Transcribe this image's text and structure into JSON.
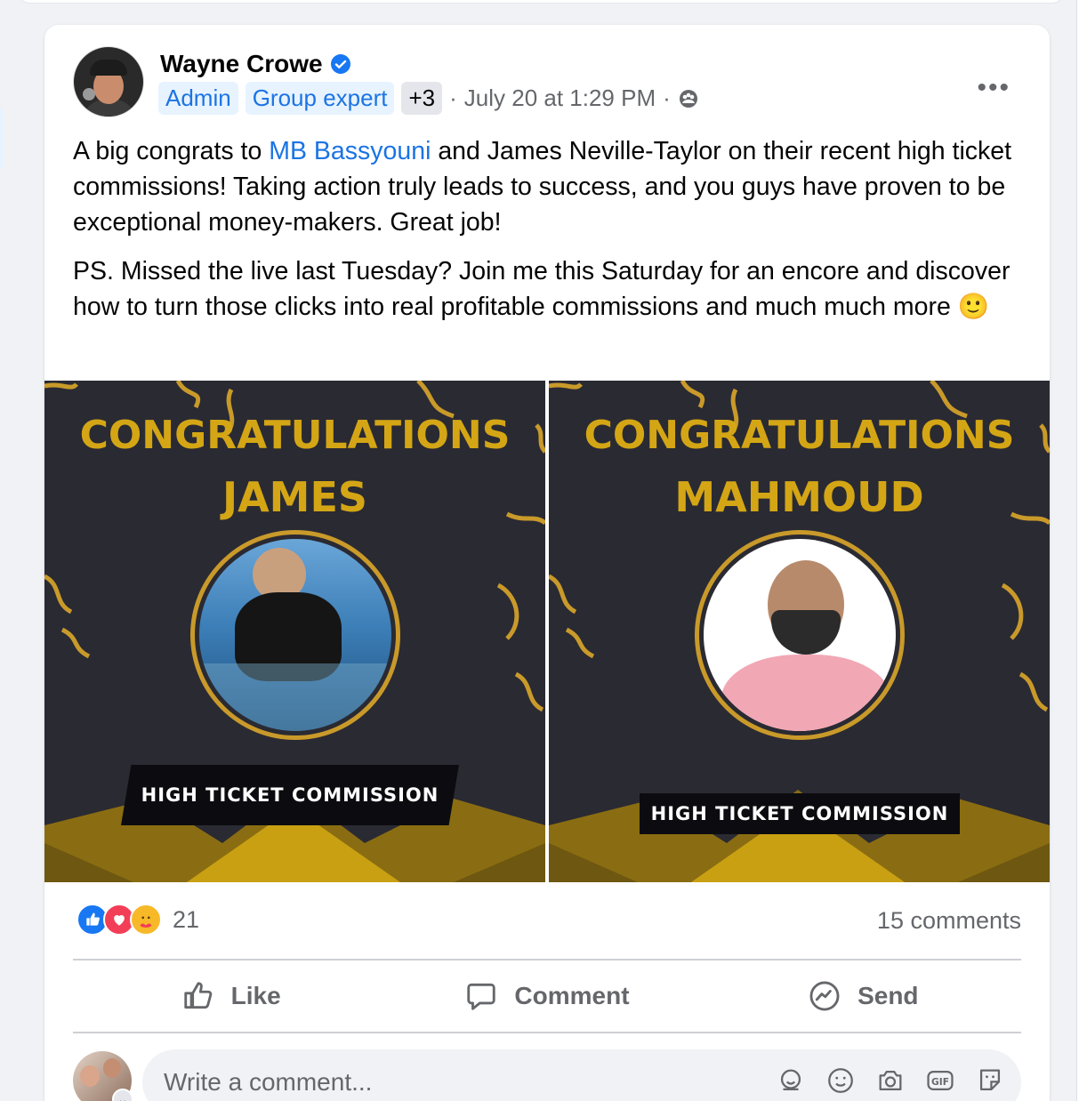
{
  "post": {
    "author": "Wayne Crowe",
    "badges": [
      "Admin",
      "Group expert",
      "+3"
    ],
    "timestamp": "July 20 at 1:29 PM",
    "separator": "·",
    "privacy_icon": "group-privacy-icon",
    "more_icon": "•••",
    "text": {
      "p1_before": "A big congrats to ",
      "mention": "MB Bassyouni",
      "p1_after": " and James Neville-Taylor on their recent high ticket commissions! Taking action truly leads to success, and you guys have proven to be exceptional money-makers. Great job!",
      "p2": "PS. Missed the live last Tuesday? Join me this Saturday for an encore and discover how to turn those clicks into real profitable commissions and much much more 🙂"
    },
    "images": [
      {
        "line1": "CONGRATULATIONS",
        "line2": "JAMES",
        "ribbon": "HIGH TICKET COMMISSION"
      },
      {
        "line1": "CONGRATULATIONS",
        "line2": "MAHMOUD",
        "ribbon": "HIGH TICKET COMMISSION"
      }
    ],
    "reactions": {
      "types": [
        "like",
        "love",
        "care"
      ],
      "count": "21"
    },
    "comments_count": "15 comments",
    "actions": {
      "like": "Like",
      "comment": "Comment",
      "send": "Send"
    },
    "comment_box": {
      "placeholder": "Write a comment..."
    }
  },
  "colors": {
    "accent": "#1b74e4",
    "gold": "#d4a615",
    "panel_bg": "#2a2a33"
  }
}
